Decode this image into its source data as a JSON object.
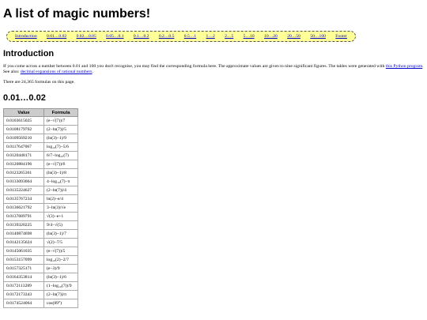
{
  "title": "A list of magic numbers!",
  "nav": [
    "Introduction",
    "0.01…0.02",
    "0.02…0.05",
    "0.05…0.1",
    "0.1…0.2",
    "0.2…0.5",
    "0.5…1",
    "1…2",
    "2…5",
    "5…10",
    "10…20",
    "20…50",
    "50…100",
    "Footer"
  ],
  "intro": {
    "heading": "Introduction",
    "p1_text": "If you come across a number between 0.01 and 100 you don't recognise, you may find the corresponding formula here. The approximate values are given to nine significant figures. The tables were generated with ",
    "p1_link": "this Python program",
    "p1_mid": ". See also: ",
    "p1_link2": "decimal expansions of rational numbers",
    "p1_end": ".",
    "p2": "There are 24,365 formulas on this page."
  },
  "section": {
    "heading": "0.01…0.02",
    "columns": [
      "Value",
      "Formula"
    ],
    "rows": [
      {
        "value": "0.0103615025",
        "formula": "(e−√(7))/7"
      },
      {
        "value": "0.0108179702",
        "formula": "(2−ln(7))/5"
      },
      {
        "value": "0.0109569210",
        "formula": "(ln(3)−1)/9"
      },
      {
        "value": "0.0117647067",
        "formula": "log₁₀(7)−5/6"
      },
      {
        "value": "0.0120448171",
        "formula": "6/7−log₁₀(7)"
      },
      {
        "value": "0.0120884196",
        "formula": "(e−√(7))/6"
      },
      {
        "value": "0.0123265361",
        "formula": "(ln(3)−1)/8"
      },
      {
        "value": "0.0133093064",
        "formula": "4−log₁₀(7)−π"
      },
      {
        "value": "0.0135224627",
        "formula": "(2−ln(7))/4"
      },
      {
        "value": "0.0135767234",
        "formula": "ln(2)−e/4"
      },
      {
        "value": "0.0136621792",
        "formula": "3−ln(3)/√e"
      },
      {
        "value": "0.0137689791",
        "formula": "√(3)−e+1"
      },
      {
        "value": "0.0139320225",
        "formula": "9/4−√(5)"
      },
      {
        "value": "0.0140874698",
        "formula": "(ln(3)−1)/7"
      },
      {
        "value": "0.0142135624",
        "formula": "√(2)−7/5"
      },
      {
        "value": "0.0145061035",
        "formula": "(e−√(7))/5"
      },
      {
        "value": "0.0153157099",
        "formula": "log₁₀(2)−2/7"
      },
      {
        "value": "0.0157325171",
        "formula": "(e−3)/9"
      },
      {
        "value": "0.0164353814",
        "formula": "(ln(3)−1)/6"
      },
      {
        "value": "0.0172113289",
        "formula": "(1−log₁₀(7))/9"
      },
      {
        "value": "0.0172173343",
        "formula": "(2−ln(7))/π"
      },
      {
        "value": "0.0174524064",
        "formula": "cos(89°)"
      }
    ]
  }
}
